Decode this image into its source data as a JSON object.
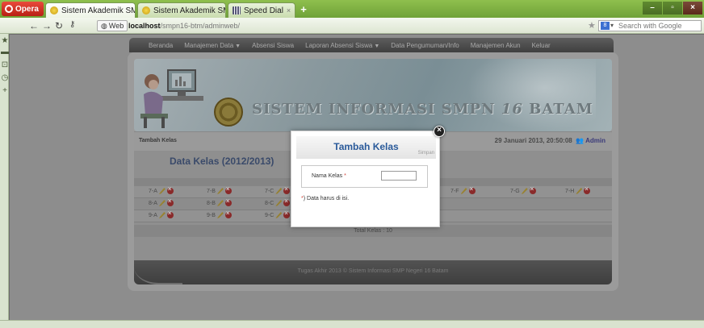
{
  "browser": {
    "menu_label": "Opera",
    "tabs": [
      {
        "label": "Sistem Akademik SMP...",
        "close": "×"
      },
      {
        "label": "Sistem Akademik SMP...",
        "close": "×"
      },
      {
        "label": "Speed Dial",
        "close": "×"
      }
    ],
    "new_tab": "+",
    "web_badge": "Web",
    "url_host": "localhost",
    "url_path": "/smpn16-btm/adminweb/",
    "search_placeholder": "Search with Google",
    "window_controls": [
      "–",
      "▫",
      "×"
    ]
  },
  "site": {
    "menu": [
      {
        "label": "Beranda"
      },
      {
        "label": "Manajemen Data",
        "dropdown": true
      },
      {
        "label": "Absensi Siswa"
      },
      {
        "label": "Laporan Absensi Siswa",
        "dropdown": true
      },
      {
        "label": "Data Pengumuman/Info"
      },
      {
        "label": "Manajemen Akun"
      },
      {
        "label": "Keluar"
      }
    ],
    "header_title": "SISTEM INFORMASI SMPN",
    "header_number": "16",
    "header_city": "BATAM",
    "breadcrumb": "Tambah Kelas",
    "datetime": "29 Januari 2013, 20:50:08",
    "user": "Admin",
    "content_title": "Data Kelas (2012/2013)",
    "class_rows": [
      [
        "7-A",
        "7-B",
        "7-C",
        "",
        "",
        "7-F",
        "7-G",
        "7-H"
      ],
      [
        "8-A",
        "8-B",
        "8-C"
      ],
      [
        "9-A",
        "9-B",
        "9-C"
      ]
    ],
    "total": "Total Kelas : 10",
    "footer": "Tugas Akhir 2013 © Sistem Informasi SMP Negeri 16 Batam"
  },
  "modal": {
    "title": "Tambah Kelas",
    "save_label": "Simpan",
    "field_label": "Nama Kelas",
    "required_mark": "*",
    "field_value": "",
    "note": ") Data harus di isi.",
    "close": "×"
  }
}
